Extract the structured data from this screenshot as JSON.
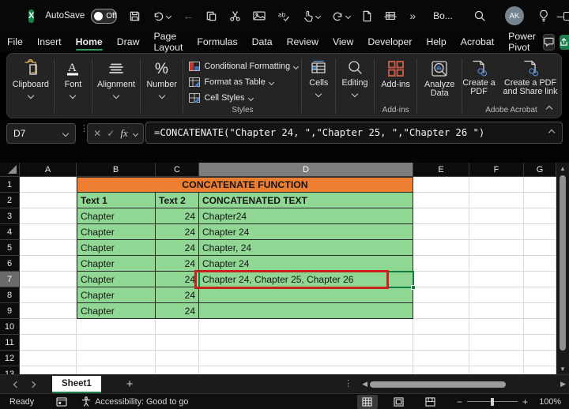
{
  "colors": {
    "accent_green": "#107C41",
    "menu_underline": "#2F9E5F",
    "table_green": "#8FD793",
    "header_orange": "#ED7D31",
    "annotation_red": "#C9211E",
    "avatar_bg": "#76848F"
  },
  "title_bar": {
    "autosave": "AutoSave",
    "autosave_state": "Off",
    "doc": "Bo...",
    "overflow": "»",
    "avatar": "AK"
  },
  "menu": {
    "items": [
      "File",
      "Insert",
      "Home",
      "Draw",
      "Page Layout",
      "Formulas",
      "Data",
      "Review",
      "View",
      "Developer",
      "Help",
      "Acrobat",
      "Power Pivot"
    ],
    "active": "Home"
  },
  "ribbon": {
    "clipboard": "Clipboard",
    "font": "Font",
    "alignment": "Alignment",
    "number": "Number",
    "conditional_formatting": "Conditional Formatting",
    "format_as_table": "Format as Table",
    "cell_styles": "Cell Styles",
    "styles_group": "Styles",
    "cells": "Cells",
    "editing": "Editing",
    "addins": "Add-ins",
    "addins_group": "Add-ins",
    "analyze_data": "Analyze Data",
    "create_pdf": "Create a PDF",
    "create_pdf_share": "Create a PDF and Share link",
    "acrobat_group": "Adobe Acrobat"
  },
  "formula_bar": {
    "name_box": "D7",
    "fx": "fx",
    "cancel": "✕",
    "enter": "✓",
    "formula": "=CONCATENATE(\"Chapter 24, \",\"Chapter 25, \",\"Chapter 26 \")"
  },
  "sheet": {
    "columns": [
      "A",
      "B",
      "C",
      "D",
      "E",
      "F",
      "G"
    ],
    "selected_column": "D",
    "selected_row": 7,
    "selected_cell": "D7",
    "title": "CONCATENATE FUNCTION",
    "col_headers": [
      "Text 1",
      "Text 2",
      "CONCATENATED TEXT"
    ],
    "rows": [
      [
        "Chapter",
        "24",
        "Chapter24"
      ],
      [
        "Chapter",
        "24",
        "Chapter 24"
      ],
      [
        "Chapter",
        "24",
        "Chapter, 24"
      ],
      [
        "Chapter",
        "24",
        "Chapter 24"
      ],
      [
        "Chapter",
        "24",
        "Chapter 24, Chapter 25, Chapter 26"
      ],
      [
        "Chapter",
        "24",
        ""
      ],
      [
        "Chapter",
        "24",
        ""
      ]
    ]
  },
  "sheet_bar": {
    "tab": "Sheet1",
    "add": "+"
  },
  "status": {
    "ready": "Ready",
    "accessibility": "Accessibility: Good to go",
    "zoom": "100%"
  }
}
